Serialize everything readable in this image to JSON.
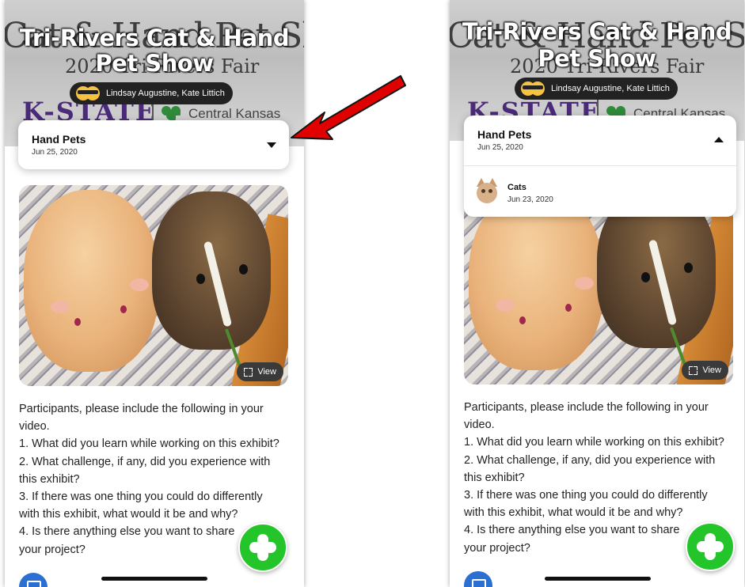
{
  "show": {
    "title_line1": "Tri-Rivers Cat & Hand",
    "title_line2": "Pet Show",
    "judges": "Lindsay Augustine, Kate Littich"
  },
  "header_image": {
    "bg_title": "Cat & Hand Pet Show",
    "bg_subtitle": "2020 Tri-Rivers Fair",
    "logo_left": "K-STATE",
    "logo_right": "Central Kansas"
  },
  "selected_category": {
    "name": "Hand Pets",
    "date": "Jun 25, 2020"
  },
  "dropdown_options": [
    {
      "name": "Cats",
      "date": "Jun 23, 2020"
    }
  ],
  "photo": {
    "view_label": "View"
  },
  "description": [
    "Participants, please include the following in your",
    "video.",
    "1. What did you learn while working on this exhibit?",
    "2. What challenge, if any, did you experience with",
    "this exhibit?",
    "3. If there was one thing you could do differently",
    "with this exhibit, what would it be and why?",
    "4. Is there anything else you want to share",
    "your project?"
  ],
  "colors": {
    "fab": "#24c52a",
    "annotation_arrow": "#e10000",
    "bottom_icon": "#2a6fd1"
  },
  "icons": [
    "sunglasses-emoji-icon",
    "caret-down-icon",
    "caret-up-icon",
    "expand-icon",
    "plus-icon",
    "cat-thumbnail-icon"
  ]
}
